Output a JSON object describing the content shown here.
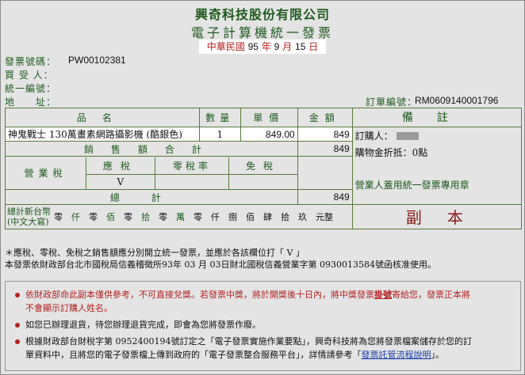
{
  "header": {
    "company": "興奇科技股份有限公司",
    "title": "電子計算機統一發票",
    "date": {
      "era": "中華民國",
      "year": "95",
      "year_label": "年",
      "month": "9",
      "month_label": "月",
      "day": "15",
      "day_label": "日"
    }
  },
  "fields": {
    "invoice_no_label": "發票號碼：",
    "invoice_no": "PW00102381",
    "buyer_label": "買 受 人：",
    "tax_id_label": "統一編號：",
    "address_label": "地　　址：",
    "order_no_label": "訂單編號：",
    "order_no": "RM0609140001796"
  },
  "table": {
    "col_item": "品名",
    "col_qty": "數量",
    "col_price": "單價",
    "col_amount": "金額",
    "col_remark": "備註",
    "item_name": "神鬼戰士 130萬畫素網路攝影機 (酷銀色)",
    "item_qty": "1",
    "item_price": "849.00",
    "item_amount": "849",
    "sales_total_label": "銷售額合計",
    "sales_total": "849",
    "tax_label": "營業稅",
    "taxable_label": "應稅",
    "zero_label": "零稅率",
    "exempt_label": "免稅",
    "taxable_mark": "V",
    "grand_total_label": "總計",
    "grand_total": "849",
    "ntd_label_1": "總計新台幣",
    "ntd_label_2": "(中文大寫)",
    "ntd_units": [
      "零",
      "仟",
      "零",
      "佰",
      "零",
      "拾",
      "零",
      "萬",
      "零",
      "仟",
      "捌",
      "佰",
      "肆",
      "拾",
      "玖",
      "元整"
    ],
    "orderer_label": "訂購人：",
    "orderer_name": "",
    "discount_label": "購物金折抵：0點",
    "stamp_label": "營業人蓋用統一發票專用章",
    "copy_label": "副　本"
  },
  "notes": {
    "line1": "＊應稅、零稅、免稅之銷售額應分別開立統一發票，並應於各該欄位打「 V 」",
    "line2": "本發票依財政部台北市國稅局信義稽徵所93年 03 月 03日財北國稅信義營業字第 0930013584號函核准使用。"
  },
  "bullets": {
    "b1a": "依財政部命此副本僅供參考，不可直接兌獎。若發票中獎，將於開獎後十日內，將中獎發票",
    "b1b": "掛號",
    "b1c": "寄給您，發票正本將",
    "b1d": "不會顯示訂購人姓名。",
    "b2": "如您已辦理退貨，待您辦理退貨完成，即會為您將發票作廢。",
    "b3a": "根據財政部台財稅字第 0952400194號訂定之「電子發票實施作業要點」，興奇科技將為您將發票檔案儲存於您的訂",
    "b3b": "單資料中，且將您的電子發票檔上傳到政府的「電子發票整合服務平台」，詳情請參考「",
    "b3link": "發票託管流程說明",
    "b3c": "」。"
  }
}
